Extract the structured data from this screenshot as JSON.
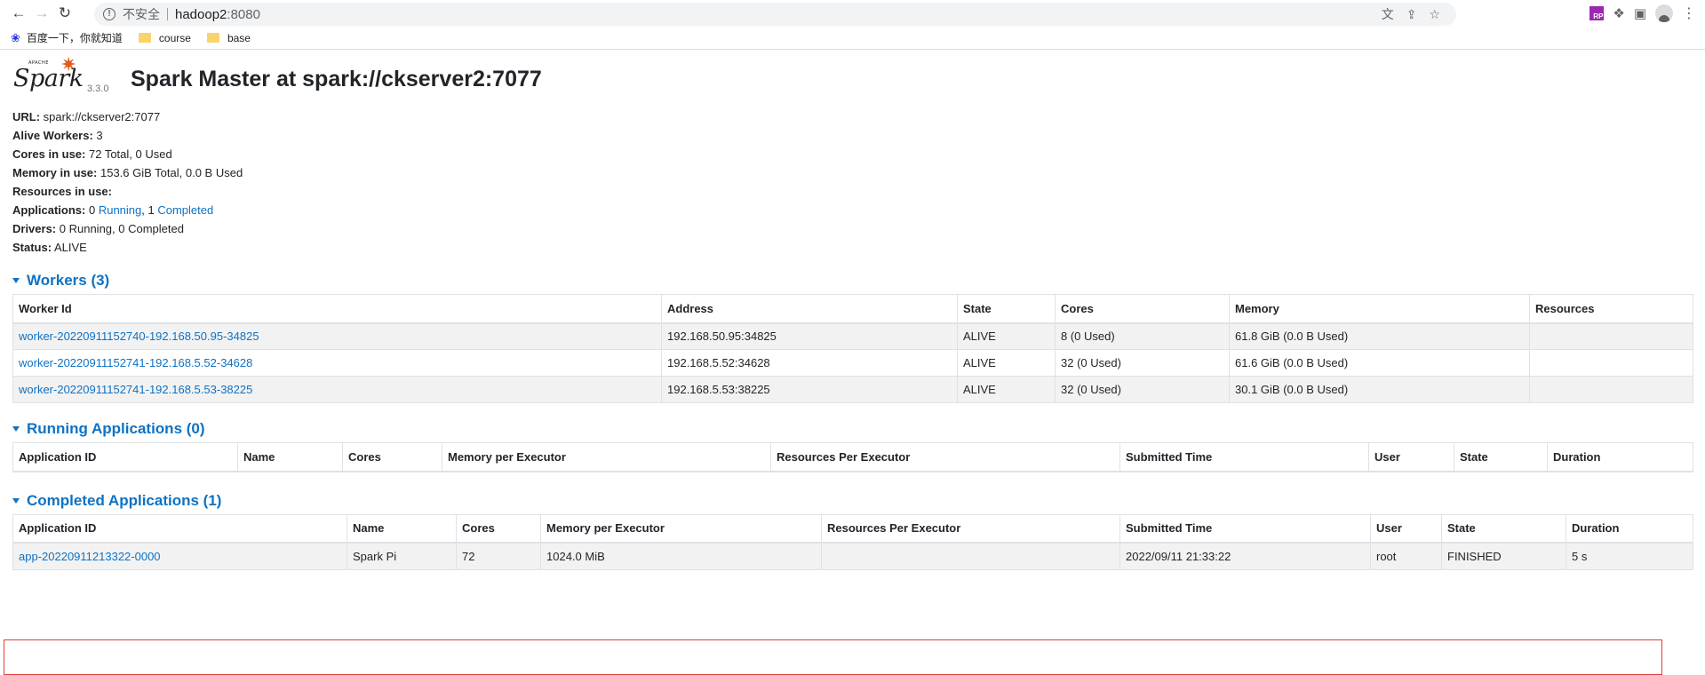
{
  "browser": {
    "insecure_label": "不安全",
    "url_host": "hadoop2",
    "url_port": ":8080",
    "bookmarks": [
      {
        "label": "百度一下，你就知道",
        "icon": "baidu-paw-icon"
      },
      {
        "label": "course",
        "icon": "folder-icon"
      },
      {
        "label": "base",
        "icon": "folder-icon"
      }
    ]
  },
  "header": {
    "logo_apache": "APACHE",
    "logo_word": "Spark",
    "version": "3.3.0",
    "title": "Spark Master at spark://ckserver2:7077"
  },
  "info": {
    "url_label": "URL:",
    "url_value": "spark://ckserver2:7077",
    "alive_label": "Alive Workers:",
    "alive_value": "3",
    "cores_label": "Cores in use:",
    "cores_value": "72 Total, 0 Used",
    "memory_label": "Memory in use:",
    "memory_value": "153.6 GiB Total, 0.0 B Used",
    "resources_label": "Resources in use:",
    "apps_label": "Applications:",
    "apps_running_count": "0",
    "apps_running_link": "Running",
    "apps_sep": ", 1",
    "apps_completed_link": "Completed",
    "drivers_label": "Drivers:",
    "drivers_value": "0 Running, 0 Completed",
    "status_label": "Status:",
    "status_value": "ALIVE"
  },
  "workers": {
    "title": "Workers (3)",
    "columns": [
      "Worker Id",
      "Address",
      "State",
      "Cores",
      "Memory",
      "Resources"
    ],
    "rows": [
      [
        "worker-20220911152740-192.168.50.95-34825",
        "192.168.50.95:34825",
        "ALIVE",
        "8 (0 Used)",
        "61.8 GiB (0.0 B Used)",
        ""
      ],
      [
        "worker-20220911152741-192.168.5.52-34628",
        "192.168.5.52:34628",
        "ALIVE",
        "32 (0 Used)",
        "61.6 GiB (0.0 B Used)",
        ""
      ],
      [
        "worker-20220911152741-192.168.5.53-38225",
        "192.168.5.53:38225",
        "ALIVE",
        "32 (0 Used)",
        "30.1 GiB (0.0 B Used)",
        ""
      ]
    ]
  },
  "running": {
    "title": "Running Applications (0)",
    "columns": [
      "Application ID",
      "Name",
      "Cores",
      "Memory per Executor",
      "Resources Per Executor",
      "Submitted Time",
      "User",
      "State",
      "Duration"
    ]
  },
  "completed": {
    "title": "Completed Applications (1)",
    "columns": [
      "Application ID",
      "Name",
      "Cores",
      "Memory per Executor",
      "Resources Per Executor",
      "Submitted Time",
      "User",
      "State",
      "Duration"
    ],
    "rows": [
      [
        "app-20220911213322-0000",
        "Spark Pi",
        "72",
        "1024.0 MiB",
        "",
        "2022/09/11 21:33:22",
        "root",
        "FINISHED",
        "5 s"
      ]
    ]
  },
  "colors": {
    "link": "#0e72c4",
    "logo_star": "#e25a1c",
    "highlight": "#e03c3c"
  }
}
